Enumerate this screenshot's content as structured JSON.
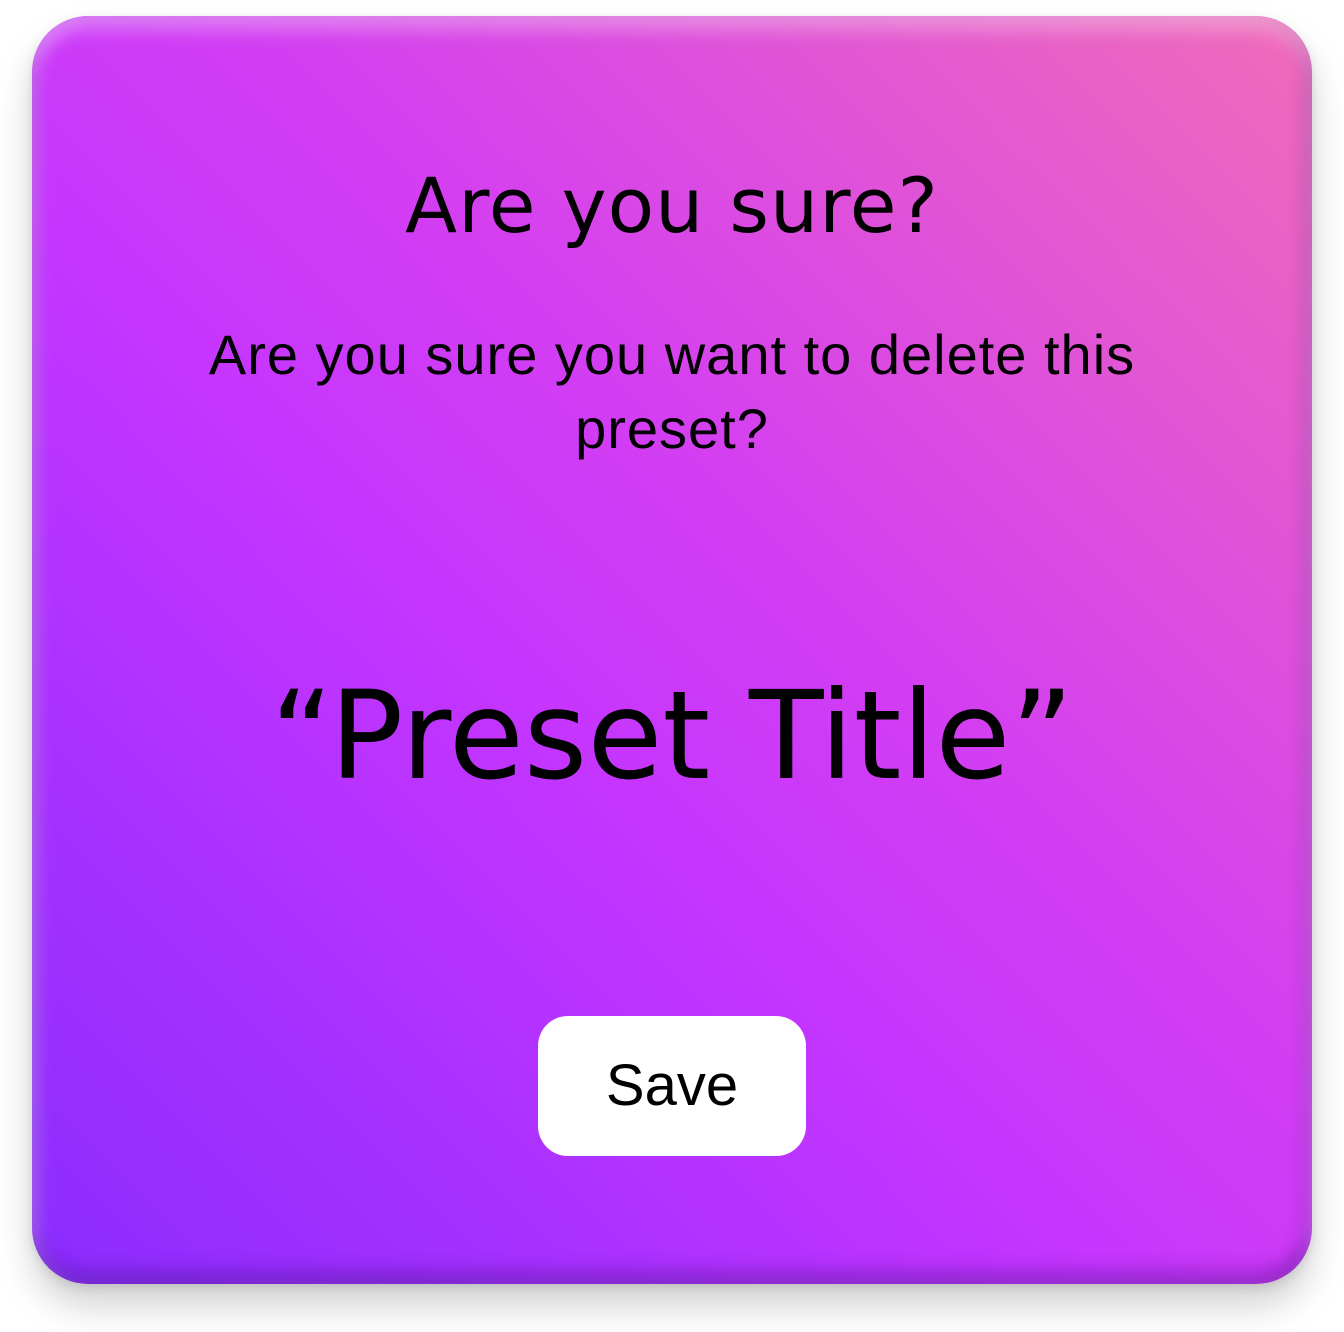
{
  "dialog": {
    "title": "Are you sure?",
    "message": "Are you sure you want to delete this preset?",
    "preset_title_display": "“Preset Title”",
    "save_label": "Save"
  },
  "colors": {
    "gradient_start": "#8a2cff",
    "gradient_mid": "#c535ff",
    "gradient_end": "#f06cb8",
    "text": "#000000",
    "button_bg": "#ffffff"
  }
}
